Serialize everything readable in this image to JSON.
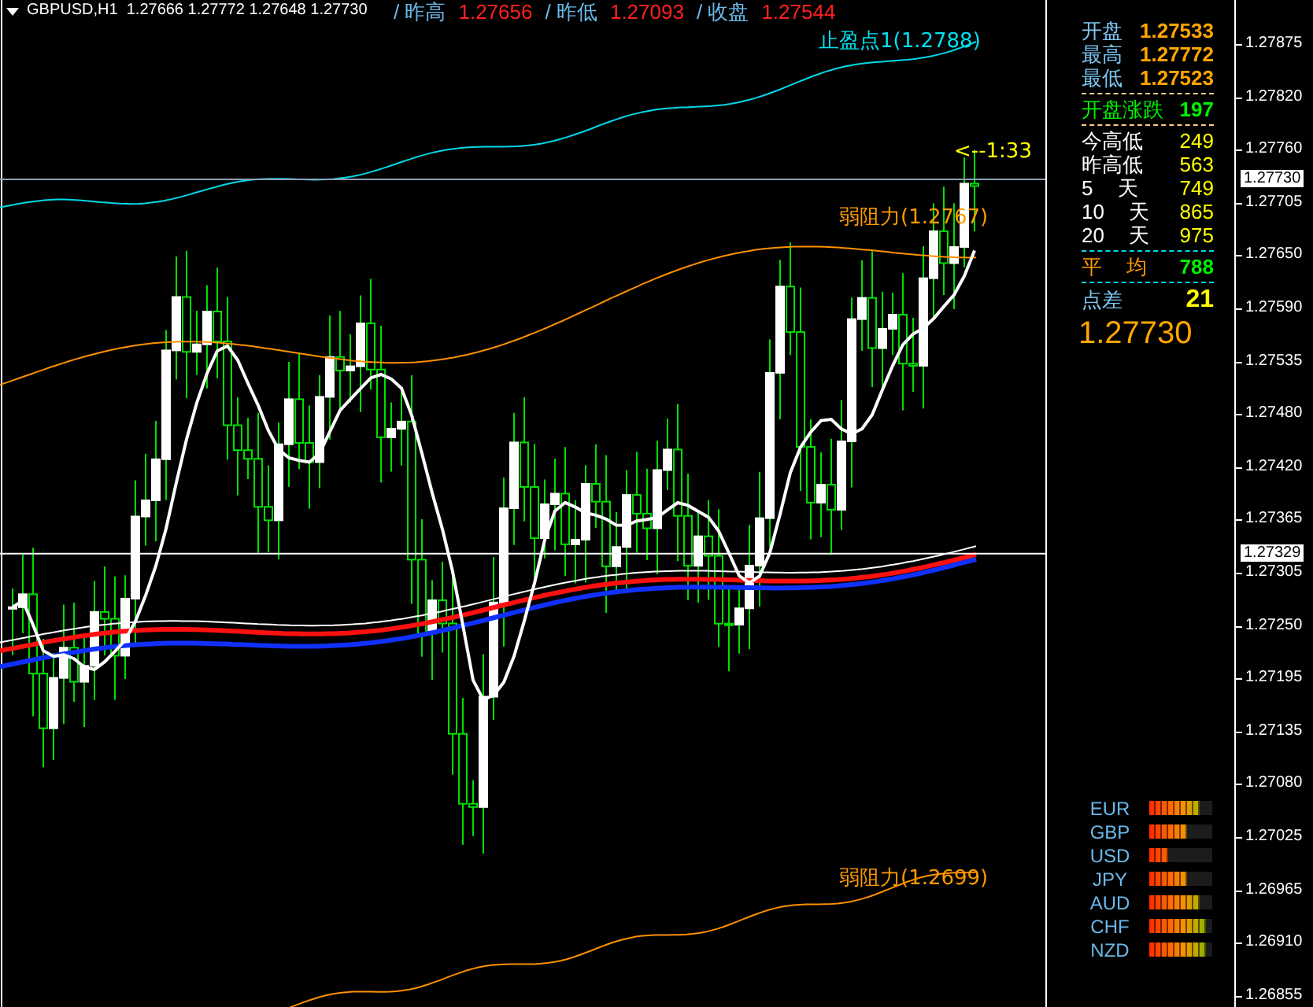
{
  "header": {
    "symbol_line": "GBPUSD,H1  1.27666 1.27772 1.27648 1.27730",
    "stats": [
      {
        "label": "/ 昨高",
        "value": "1.27656"
      },
      {
        "label": "/ 昨低",
        "value": "1.27093"
      },
      {
        "label": "/ 收盘",
        "value": "1.27544"
      }
    ]
  },
  "chart": {
    "annotations": [
      {
        "kind": "target",
        "text": "止盈点1(1.2788)"
      },
      {
        "kind": "ratio",
        "text": "<--1:33"
      },
      {
        "kind": "resistance_upper",
        "text": "弱阻力(1.2767)"
      },
      {
        "kind": "resistance_lower",
        "text": "弱阻力(1.2699)"
      }
    ],
    "price_axis": {
      "ticks": [
        "1.27875",
        "1.27820",
        "1.27760",
        "1.27705",
        "1.27650",
        "1.27590",
        "1.27535",
        "1.27480",
        "1.27420",
        "1.27365",
        "1.27305",
        "1.27250",
        "1.27195",
        "1.27135",
        "1.27080",
        "1.27025",
        "1.26965",
        "1.26910",
        "1.26855"
      ],
      "price_tags": [
        "1.27730",
        "1.27329"
      ]
    }
  },
  "info_panel": {
    "rows": [
      {
        "kind": "price",
        "label": "开盘",
        "value": "1.27533"
      },
      {
        "kind": "price",
        "label": "最高",
        "value": "1.27772"
      },
      {
        "kind": "price",
        "label": "最低",
        "value": "1.27523"
      },
      {
        "kind": "change",
        "label": "开盘涨跌",
        "value": "197"
      },
      {
        "kind": "range",
        "label": "今高低",
        "value": "249"
      },
      {
        "kind": "range",
        "label": "昨高低",
        "value": "563"
      },
      {
        "kind": "range",
        "label": "5 天",
        "value": "749"
      },
      {
        "kind": "range",
        "label": "10 天",
        "value": "865"
      },
      {
        "kind": "range",
        "label": "20 天",
        "value": "975"
      },
      {
        "kind": "average",
        "label": "平 均",
        "value": "788"
      },
      {
        "kind": "spread",
        "label": "点差",
        "value": "21"
      }
    ],
    "current_price": "1.27730"
  },
  "currency_strength": [
    {
      "name": "EUR",
      "level": 0.8
    },
    {
      "name": "GBP",
      "level": 0.6
    },
    {
      "name": "USD",
      "level": 0.3
    },
    {
      "name": "JPY",
      "level": 0.6
    },
    {
      "name": "AUD",
      "level": 0.8
    },
    {
      "name": "CHF",
      "level": 0.9
    },
    {
      "name": "NZD",
      "level": 0.9
    }
  ]
}
